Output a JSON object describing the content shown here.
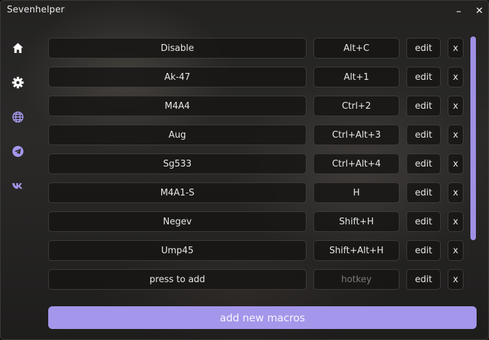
{
  "window": {
    "title": "Sevenhelper",
    "minimize_label": "–",
    "close_label": "✕"
  },
  "sidebar": {
    "items": [
      {
        "icon": "home-icon"
      },
      {
        "icon": "gear-icon"
      },
      {
        "icon": "globe-icon"
      },
      {
        "icon": "telegram-icon"
      },
      {
        "icon": "vk-icon"
      }
    ],
    "accent_color": "#a496ea"
  },
  "macros": [
    {
      "name": "Disable",
      "hotkey": "Alt+C",
      "edit": "edit",
      "remove": "x"
    },
    {
      "name": "Ak-47",
      "hotkey": "Alt+1",
      "edit": "edit",
      "remove": "x"
    },
    {
      "name": "M4A4",
      "hotkey": "Ctrl+2",
      "edit": "edit",
      "remove": "x"
    },
    {
      "name": "Aug",
      "hotkey": "Ctrl+Alt+3",
      "edit": "edit",
      "remove": "x"
    },
    {
      "name": "Sg533",
      "hotkey": "Ctrl+Alt+4",
      "edit": "edit",
      "remove": "x"
    },
    {
      "name": "M4A1-S",
      "hotkey": "H",
      "edit": "edit",
      "remove": "x"
    },
    {
      "name": "Negev",
      "hotkey": "Shift+H",
      "edit": "edit",
      "remove": "x"
    },
    {
      "name": "Ump45",
      "hotkey": "Shift+Alt+H",
      "edit": "edit",
      "remove": "x"
    }
  ],
  "new_row": {
    "name_placeholder": "press to add",
    "hotkey_placeholder": "hotkey",
    "edit": "edit",
    "remove": "x"
  },
  "add_button_label": "add new macros"
}
